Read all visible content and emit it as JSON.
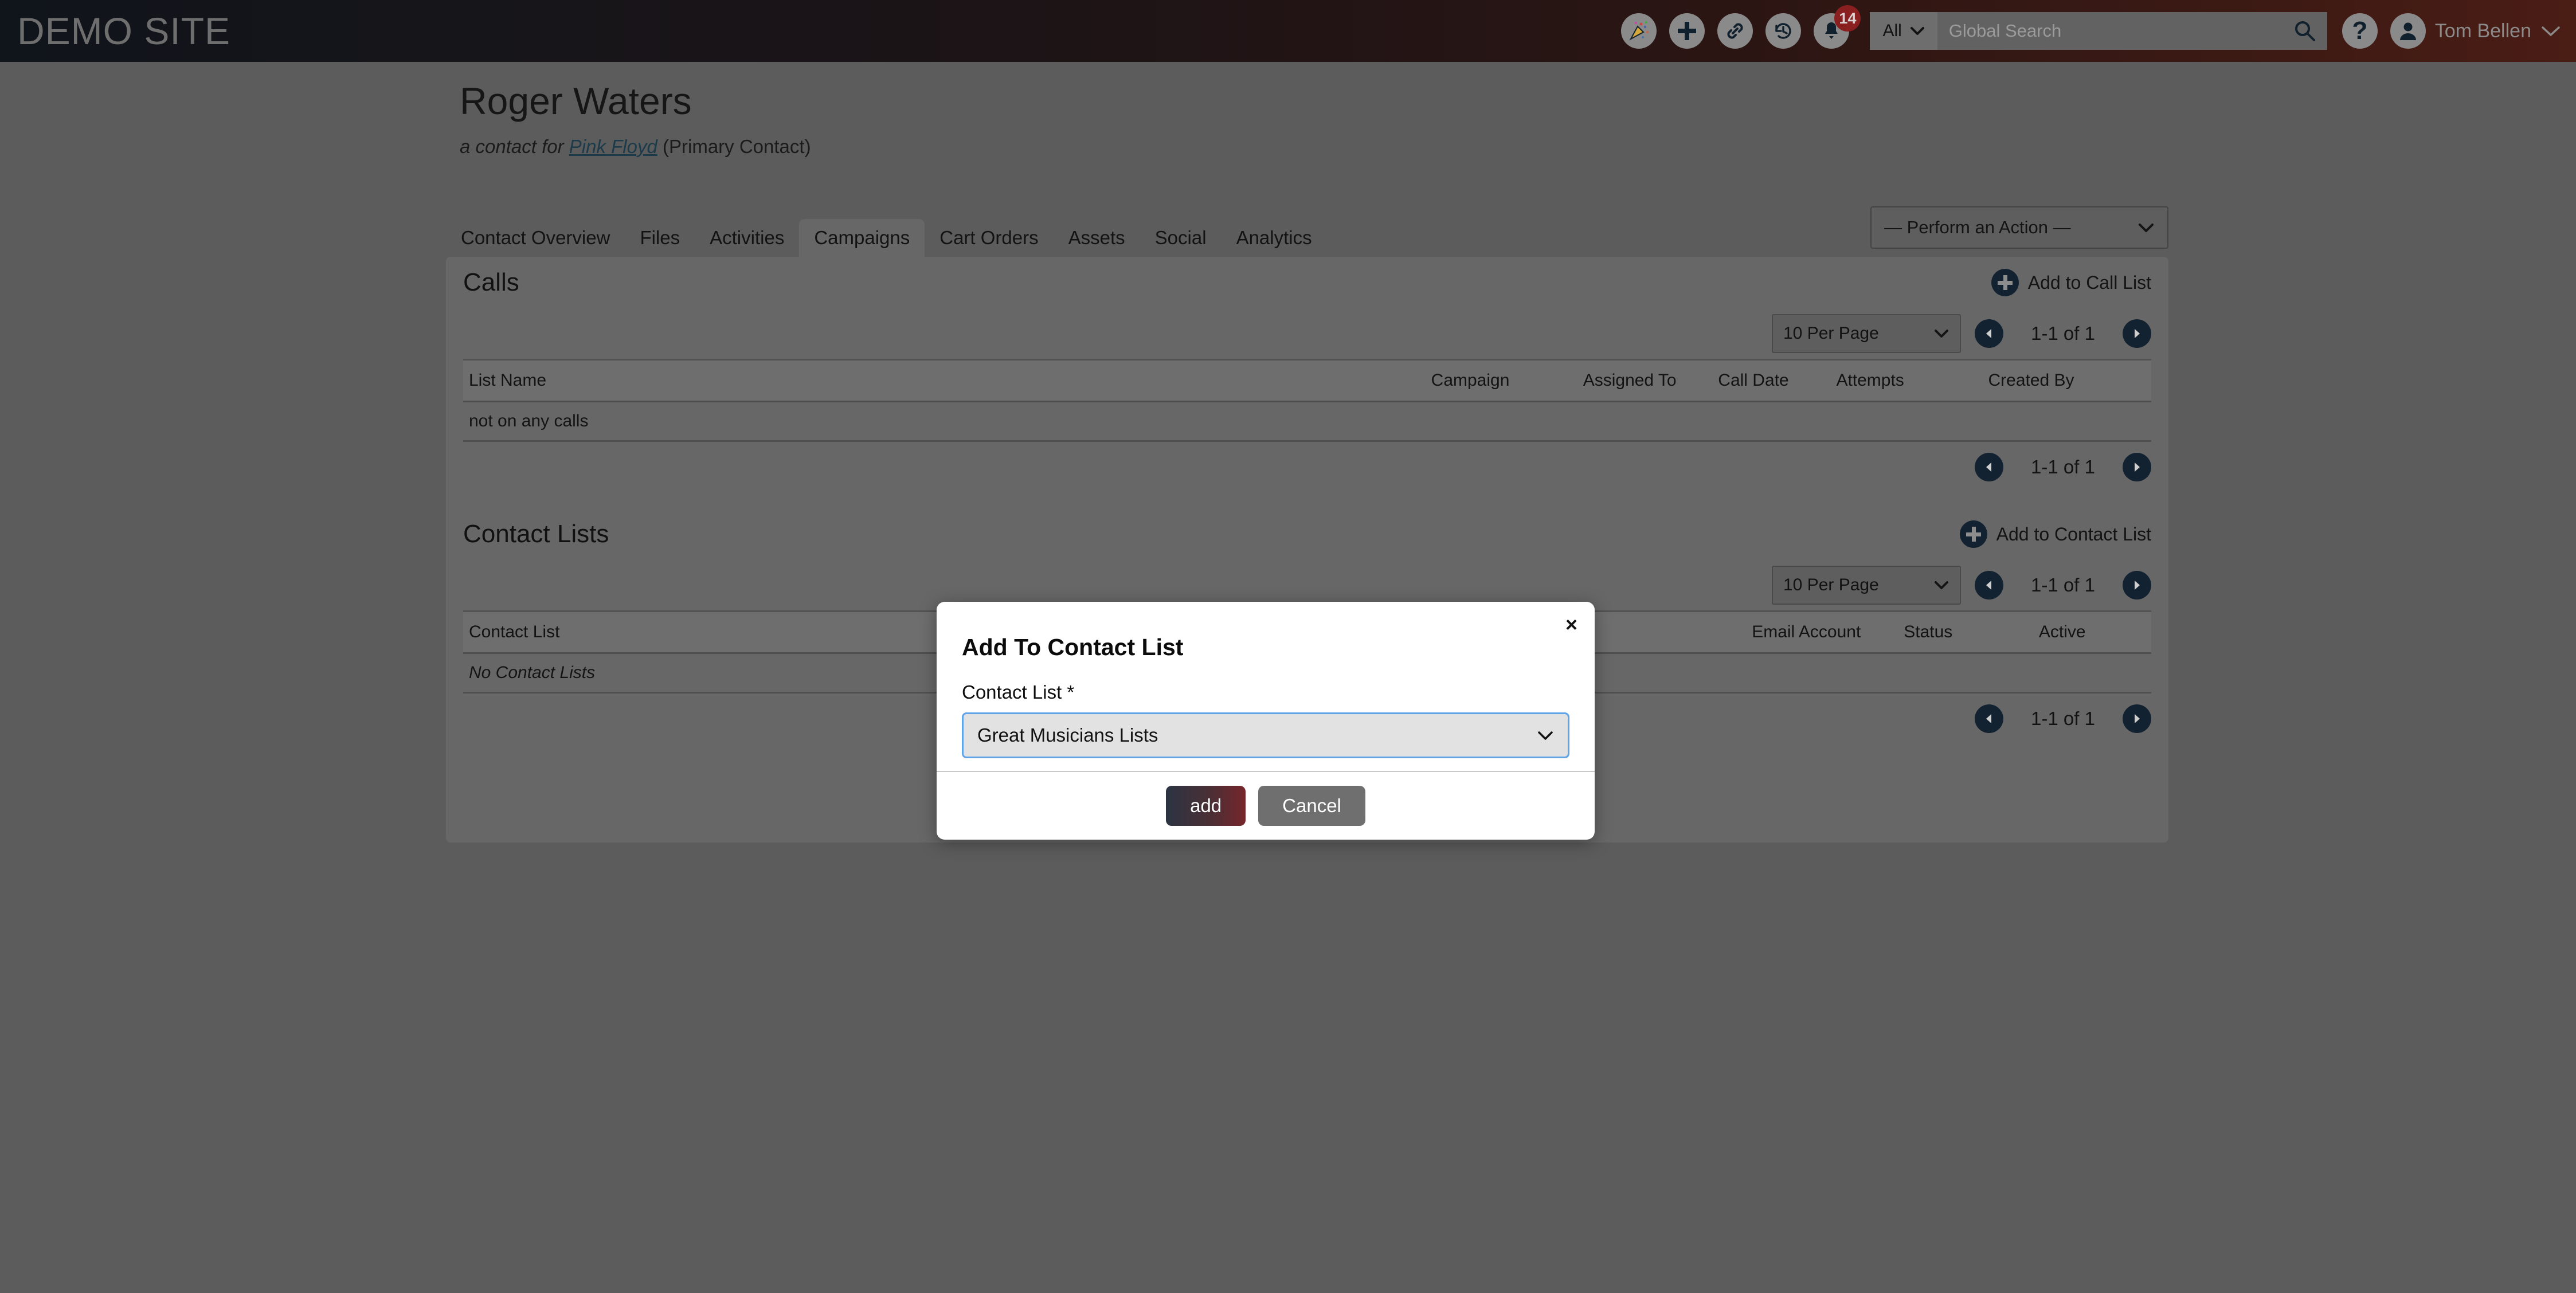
{
  "header": {
    "brand": "DEMO SITE",
    "icons": [
      {
        "name": "party-popper-icon",
        "glyph": "🎉"
      },
      {
        "name": "plus-icon",
        "glyph": "+"
      },
      {
        "name": "link-icon",
        "glyph": "🔗"
      },
      {
        "name": "history-icon",
        "glyph": "↺"
      },
      {
        "name": "bell-icon",
        "glyph": "🔔"
      }
    ],
    "notification_count": "14",
    "search_scope": "All",
    "search_placeholder": "Global Search",
    "help_label": "?",
    "user_name": "Tom Bellen"
  },
  "page": {
    "title": "Roger Waters",
    "subtitle_prefix": "a contact for",
    "subtitle_link": "Pink Floyd",
    "subtitle_suffix": "(Primary Contact)"
  },
  "tabs": [
    {
      "label": "Contact Overview",
      "active": false
    },
    {
      "label": "Files",
      "active": false
    },
    {
      "label": "Activities",
      "active": false
    },
    {
      "label": "Campaigns",
      "active": true
    },
    {
      "label": "Cart Orders",
      "active": false
    },
    {
      "label": "Assets",
      "active": false
    },
    {
      "label": "Social",
      "active": false
    },
    {
      "label": "Analytics",
      "active": false
    }
  ],
  "action_select": {
    "value": "— Perform an Action —"
  },
  "calls_section": {
    "title": "Calls",
    "add_label": "Add to Call List",
    "per_page": "10 Per Page",
    "page_range_top": "1-1 of 1",
    "page_range_bottom": "1-1 of 1",
    "columns": [
      "List Name",
      "Campaign",
      "Assigned To",
      "Call Date",
      "Attempts",
      "Created By"
    ],
    "empty_text": "not on any calls"
  },
  "contact_lists_section": {
    "title": "Contact Lists",
    "add_label": "Add to Contact List",
    "per_page": "10 Per Page",
    "page_range_top": "1-1 of 1",
    "page_range_bottom": "1-1 of 1",
    "columns": [
      "Contact List",
      "Email Account",
      "Status",
      "Active"
    ],
    "empty_text": "No Contact Lists"
  },
  "modal": {
    "title": "Add To Contact List",
    "close_label": "×",
    "field_label": "Contact List *",
    "select_value": "Great Musicians Lists",
    "add_label": "add",
    "cancel_label": "Cancel"
  },
  "colors": {
    "page_bg": "#5c5c5c",
    "card_bg": "#676767",
    "header_start": "#10141b",
    "header_end": "#4a1d15",
    "accent_dark": "#132231",
    "badge_red": "#8a1f1f",
    "focus_blue": "#5fa3e8"
  }
}
